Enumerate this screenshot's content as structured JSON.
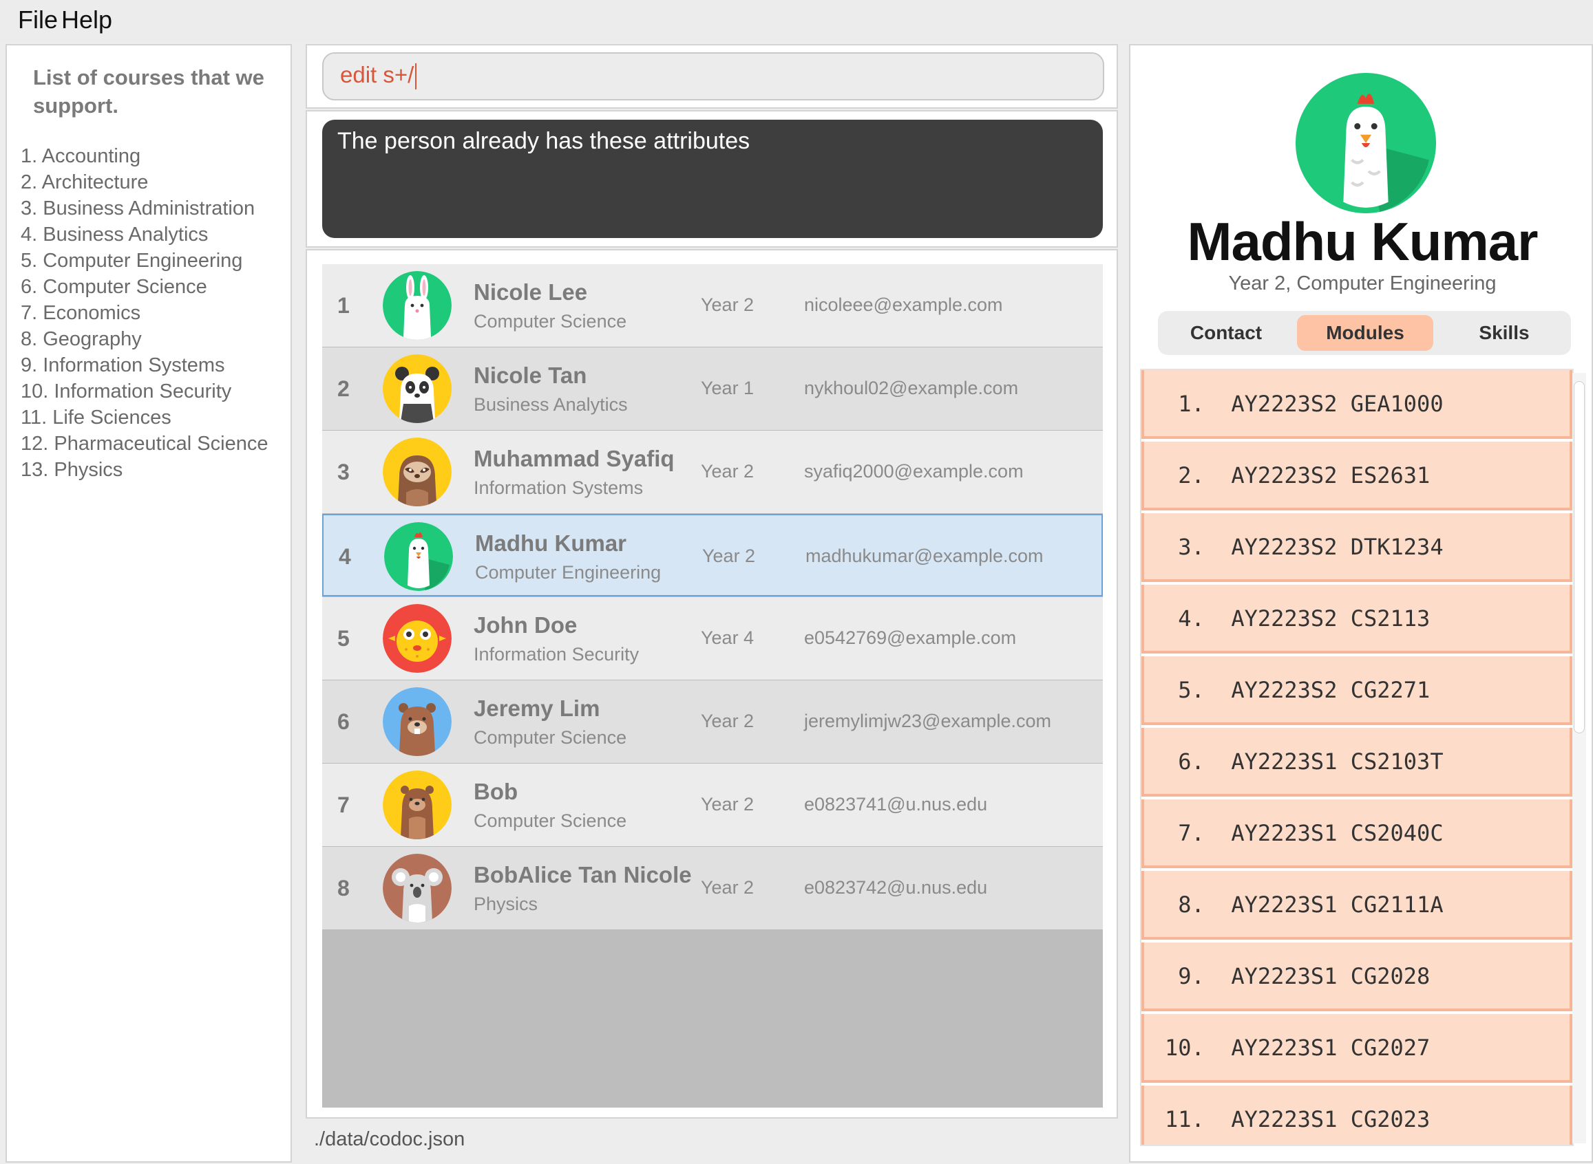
{
  "menu": {
    "file": "File",
    "help": "Help"
  },
  "courses": {
    "title": "List of courses that we support.",
    "items": [
      "1. Accounting",
      "2. Architecture",
      "3. Business Administration",
      "4. Business Analytics",
      "5. Computer Engineering",
      "6. Computer Science",
      "7. Economics",
      "8. Geography",
      "9. Information Systems",
      "10. Information Security",
      "11. Life Sciences",
      "12. Pharmaceutical Science",
      "13. Physics"
    ]
  },
  "command": {
    "value": "edit s+/"
  },
  "result": {
    "message": "The person already has these attributes"
  },
  "persons": [
    {
      "index": "1",
      "name": "Nicole Lee",
      "course": "Computer Science",
      "year": "Year 2",
      "email": "nicoleee@example.com",
      "avatar": "rabbit-icon"
    },
    {
      "index": "2",
      "name": "Nicole Tan",
      "course": "Business Analytics",
      "year": "Year 1",
      "email": "nykhoul02@example.com",
      "avatar": "panda-icon"
    },
    {
      "index": "3",
      "name": "Muhammad Syafiq",
      "course": "Information Systems",
      "year": "Year 2",
      "email": "syafiq2000@example.com",
      "avatar": "sloth-icon"
    },
    {
      "index": "4",
      "name": "Madhu Kumar",
      "course": "Computer Engineering",
      "year": "Year 2",
      "email": "madhukumar@example.com",
      "avatar": "chicken-icon",
      "selected": true
    },
    {
      "index": "5",
      "name": "John Doe",
      "course": "Information Security",
      "year": "Year 4",
      "email": "e0542769@example.com",
      "avatar": "pufferfish-icon"
    },
    {
      "index": "6",
      "name": "Jeremy Lim",
      "course": "Computer Science",
      "year": "Year 2",
      "email": "jeremylimjw23@example.com",
      "avatar": "beaver-icon"
    },
    {
      "index": "7",
      "name": "Bob",
      "course": "Computer Science",
      "year": "Year 2",
      "email": "e0823741@u.nus.edu",
      "avatar": "groundhog-icon"
    },
    {
      "index": "8",
      "name": "BobAlice Tan Nicole",
      "course": "Physics",
      "year": "Year 2",
      "email": "e0823742@u.nus.edu",
      "avatar": "koala-icon"
    }
  ],
  "status": {
    "path": "./data/codoc.json"
  },
  "detail": {
    "name": "Madhu Kumar",
    "subtitle": "Year 2, Computer Engineering",
    "avatar": "chicken-icon",
    "tabs": [
      "Contact",
      "Modules",
      "Skills"
    ],
    "active_tab": "Modules",
    "modules": [
      " 1.  AY2223S2 GEA1000",
      " 2.  AY2223S2 ES2631",
      " 3.  AY2223S2 DTK1234",
      " 4.  AY2223S2 CS2113",
      " 5.  AY2223S2 CG2271",
      " 6.  AY2223S1 CS2103T",
      " 7.  AY2223S1 CS2040C",
      " 8.  AY2223S1 CG2111A",
      " 9.  AY2223S1 CG2028",
      "10.  AY2223S1 CG2027",
      "11.  AY2223S1 CG2023"
    ]
  },
  "colors": {
    "accent": "#fdc3a4",
    "module_bg": "#fdddc9",
    "selected_row": "#d6e6f5",
    "command_text": "#d9563a"
  }
}
